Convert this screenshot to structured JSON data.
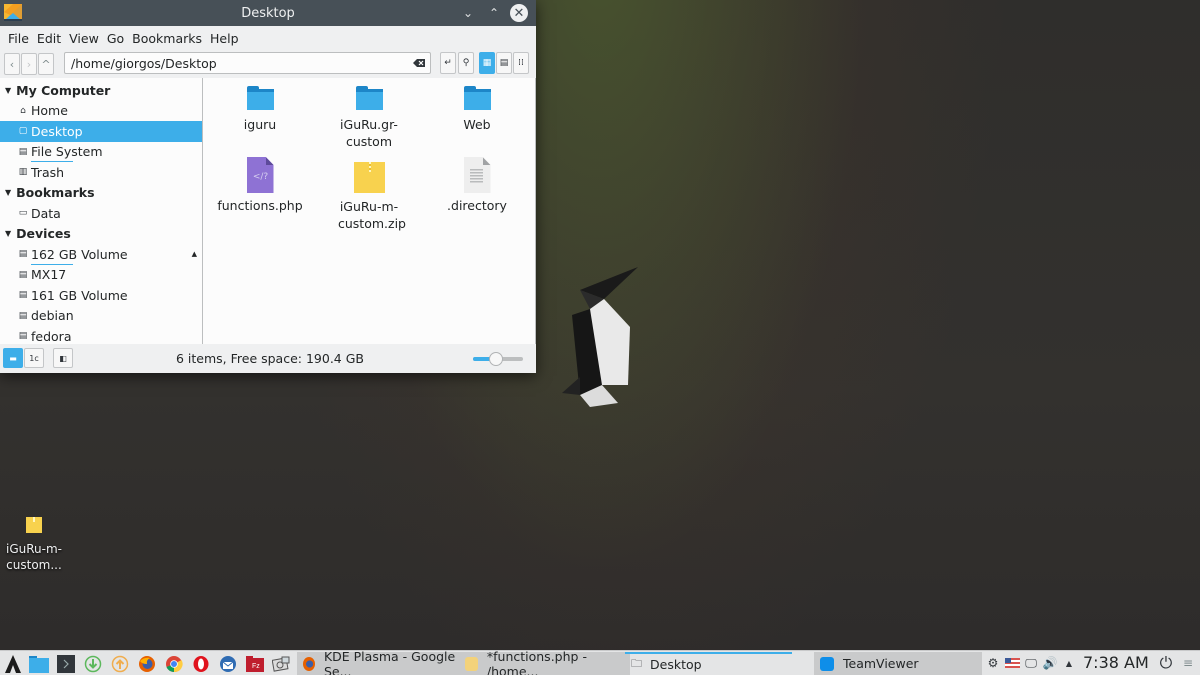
{
  "window": {
    "title": "Desktop",
    "controls": {
      "minimize": "⌄",
      "maximize": "⌃",
      "close": "✕"
    }
  },
  "menubar": [
    "File",
    "Edit",
    "View",
    "Go",
    "Bookmarks",
    "Help"
  ],
  "toolbar": {
    "back": "‹",
    "forward": "›",
    "up": "^",
    "location": "/home/giorgos/Desktop",
    "buttons": [
      "open-terminal-icon",
      "search-icon",
      "icons-view-icon",
      "compact-view-icon",
      "details-view-icon"
    ],
    "active_view": "icons"
  },
  "places": {
    "sections": [
      {
        "label": "My Computer",
        "items": [
          {
            "label": "Home",
            "icon": "⌂"
          },
          {
            "label": "Desktop",
            "icon": "▢",
            "selected": true
          },
          {
            "label": "File System",
            "icon": "▤",
            "usage_bar": true
          },
          {
            "label": "Trash",
            "icon": "▥"
          }
        ]
      },
      {
        "label": "Bookmarks",
        "items": [
          {
            "label": "Data",
            "icon": "▭"
          }
        ]
      },
      {
        "label": "Devices",
        "items": [
          {
            "label": "162 GB Volume",
            "icon": "▤",
            "usage_bar": true,
            "eject": "▲"
          },
          {
            "label": "MX17",
            "icon": "▤"
          },
          {
            "label": "161 GB Volume",
            "icon": "▤"
          },
          {
            "label": "debian",
            "icon": "▤"
          },
          {
            "label": "fedora",
            "icon": "▤"
          }
        ]
      }
    ]
  },
  "files": [
    {
      "name": "iguru",
      "type": "folder"
    },
    {
      "name": "iGuRu.gr-custom",
      "type": "folder"
    },
    {
      "name": "Web",
      "type": "folder"
    },
    {
      "name": "functions.php",
      "type": "php"
    },
    {
      "name": "iGuRu-m-custom.zip",
      "type": "zip"
    },
    {
      "name": ".directory",
      "type": "text"
    }
  ],
  "statusbar": {
    "text": "6 items, Free space: 190.4 GB",
    "zoom_level_percent": 45,
    "buttons": [
      "places-panel-icon",
      "information-panel-icon",
      "split-view-icon"
    ]
  },
  "desktop": {
    "icons": [
      {
        "label": "iGuRu-m-custom...",
        "type": "zip"
      }
    ]
  },
  "taskbar": {
    "launchers": [
      "application-menu-icon",
      "file-manager-icon",
      "terminal-icon",
      "download-icon",
      "update-icon",
      "firefox-icon",
      "chrome-icon",
      "opera-icon",
      "thunderbird-icon",
      "filezilla-icon",
      "screenshot-icon"
    ],
    "tasks": [
      {
        "label": "KDE Plasma - Google Se...",
        "icon": "firefox-icon"
      },
      {
        "label": "*functions.php - /home...",
        "icon": "editor-icon"
      },
      {
        "label": "Desktop",
        "icon": "folder-icon",
        "active": true
      },
      {
        "label": "TeamViewer",
        "icon": "teamviewer-icon"
      }
    ],
    "tray": [
      "network-settings-icon",
      "keyboard-layout-us-icon",
      "display-icon",
      "volume-icon",
      "show-hidden-icon"
    ],
    "clock": "7:38 AM"
  },
  "colors": {
    "accent": "#3daee9",
    "titlebar": "#475057",
    "window_bg": "#eff0f1"
  }
}
